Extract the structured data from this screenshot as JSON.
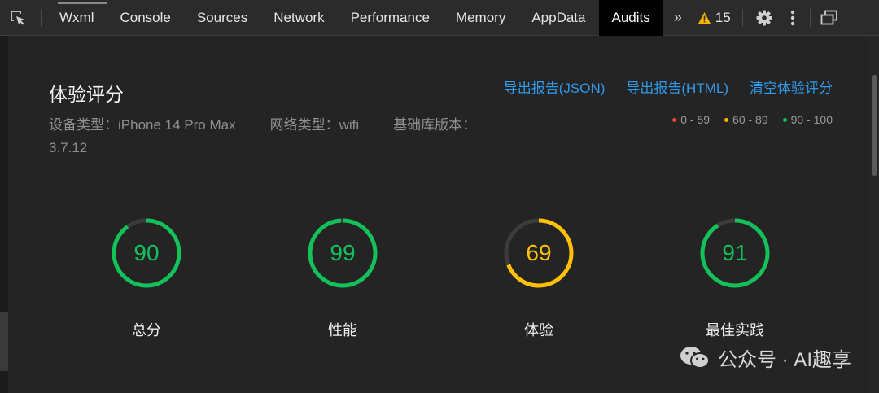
{
  "toolbar": {
    "tabs": [
      {
        "label": "Wxml"
      },
      {
        "label": "Console"
      },
      {
        "label": "Sources"
      },
      {
        "label": "Network"
      },
      {
        "label": "Performance"
      },
      {
        "label": "Memory"
      },
      {
        "label": "AppData"
      },
      {
        "label": "Audits"
      }
    ],
    "selected_tab": "Audits",
    "more_glyph": "»",
    "warning_count": "15",
    "icons": [
      "inspect-icon",
      "chevron-double-right-icon",
      "warning-icon",
      "gear-icon",
      "more-vertical-icon",
      "undock-icon"
    ]
  },
  "report": {
    "title": "体验评分",
    "device_type": "设备类型：iPhone 14 Pro Max",
    "network_type": "网络类型：wifi",
    "lib_version": "基础库版本：3.7.12",
    "links": {
      "export_json": "导出报告(JSON)",
      "export_html": "导出报告(HTML)",
      "clear": "清空体验评分"
    },
    "legend": [
      {
        "label": "0 - 59",
        "color": "#e5453d"
      },
      {
        "label": "60 - 89",
        "color": "#ffb400"
      },
      {
        "label": "90 - 100",
        "color": "#13c15a"
      }
    ]
  },
  "scores": [
    {
      "label": "总分",
      "value": 90,
      "color": "#13c15a"
    },
    {
      "label": "性能",
      "value": 99,
      "color": "#13c15a"
    },
    {
      "label": "体验",
      "value": 69,
      "color": "#ffc107"
    },
    {
      "label": "最佳实践",
      "value": 91,
      "color": "#13c15a"
    }
  ],
  "watermark": "公众号 · AI趣享"
}
